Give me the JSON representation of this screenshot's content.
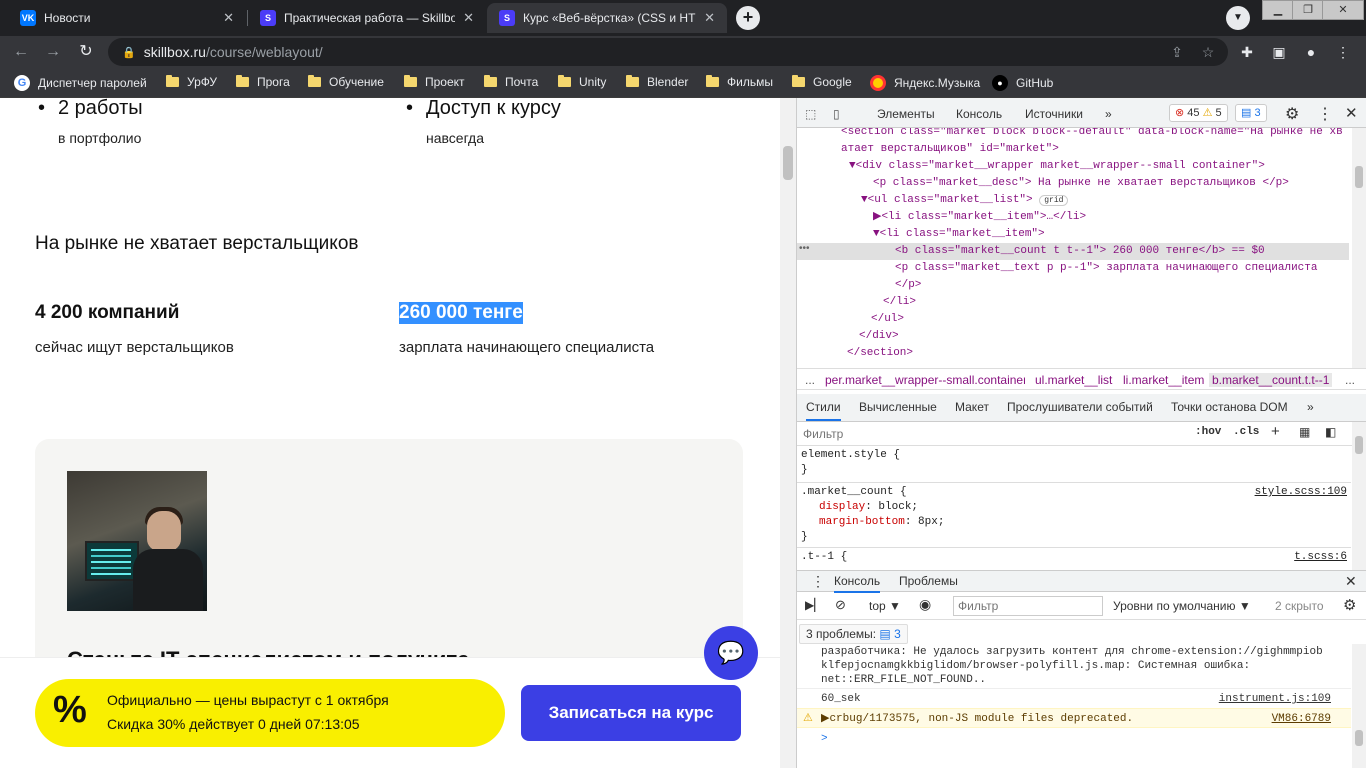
{
  "tabs": [
    {
      "title": "Новости",
      "favicon": "vk-icon",
      "color": "#0077ff",
      "glyph": "VK"
    },
    {
      "title": "Практическая работа — Skillbox",
      "favicon": "skillbox-icon",
      "color": "#4b3cf7",
      "glyph": "S"
    },
    {
      "title": "Курс «Веб-вёрстка» (CSS и HTML",
      "favicon": "skillbox-icon",
      "color": "#4b3cf7",
      "glyph": "S"
    }
  ],
  "address": {
    "host": "skillbox.ru",
    "path": "/course/weblayout/"
  },
  "bookmarks": [
    "Диспетчер паролей",
    "УрФУ",
    "Прога",
    "Обучение",
    "Проект",
    "Почта",
    "Unity",
    "Blender",
    "Фильмы",
    "Google",
    "Яндекс.Музыка",
    "GitHub"
  ],
  "page": {
    "features": [
      {
        "title": "2 работы",
        "sub": "в портфолио"
      },
      {
        "title": "Доступ к курсу",
        "sub": "навсегда"
      }
    ],
    "market_title": "На рынке не хватает верстальщиков",
    "stats": [
      {
        "value": "4 200 компаний",
        "label": "сейчас ищут верстальщиков"
      },
      {
        "value": "260 000 тенге",
        "label": "зарплата начинающего специалиста"
      }
    ],
    "card_title": "Станьте IT-специалистом и получите",
    "promo": {
      "symbol": "%",
      "line1": "Официально — цены вырастут с 1 октября",
      "line2": "Скидка 30% действует 0 дней 07:13:05"
    },
    "cta": "Записаться на курс"
  },
  "devtools": {
    "tabs": [
      "Элементы",
      "Консоль",
      "Источники"
    ],
    "errors": "45",
    "warnings": "5",
    "issues": "3",
    "dom": [
      {
        "t": "<section class=\"market block block--default\" data-block-name=\"На рынке не хв",
        "d": 0
      },
      {
        "t": "атает верстальщиков\" id=\"market\">",
        "d": 1
      },
      {
        "t": "▼<div class=\"market__wrapper market__wrapper--small container\">",
        "d": 1
      },
      {
        "t": "<p class=\"market__desc\"> На рынке не хватает верстальщиков </p>",
        "d": 2
      },
      {
        "t": "▼<ul class=\"market__list\">",
        "d": 2,
        "extra": "grid"
      },
      {
        "t": "▶<li class=\"market__item\">…</li>",
        "d": 3
      },
      {
        "t": "▼<li class=\"market__item\">",
        "d": 3
      },
      {
        "t": "<b class=\"market__count t t--1\"> 260 000 тенге</b> == $0",
        "d": 4,
        "hl": true
      },
      {
        "t": "<p class=\"market__text p p--1\"> зарплата начинающего специалиста",
        "d": 4
      },
      {
        "t": "</p>",
        "d": 4
      },
      {
        "t": "</li>",
        "d": 3
      },
      {
        "t": "</ul>",
        "d": 2
      },
      {
        "t": "</div>",
        "d": 1
      },
      {
        "t": "</section>",
        "d": 0
      }
    ],
    "crumbs": [
      "per.market__wrapper--small.container",
      "ul.market__list",
      "li.market__item",
      "b.market__count.t.t--1"
    ],
    "style_tabs": [
      "Стили",
      "Вычисленные",
      "Макет",
      "Прослушиватели событий",
      "Точки останова DOM"
    ],
    "filter_placeholder": "Фильтр",
    "filter_tools": [
      ":hov",
      ".cls"
    ],
    "rules": {
      "element": "element.style {",
      "close": "}",
      "selector": ".market__count {",
      "source": "style.scss:109",
      "p1": "display",
      "v1": ": block;",
      "p2": "margin-bottom",
      "v2": ": 8px;",
      "next": ".t--1 {",
      "next_src": "t.scss:6"
    },
    "drawer_tabs": [
      "Консоль",
      "Проблемы"
    ],
    "console": {
      "context": "top ▼",
      "filter": "Фильтр",
      "levels": "Уровни по умолчанию ▼",
      "hidden": "2 скрыто",
      "issues_label": "3 проблемы:",
      "issues_count": "3",
      "msg1a": "разработчика: Не удалось загрузить контент для chrome-extension://gighmmpiob",
      "msg1b": "klfepjocnamgkkbiglidom/browser-polyfill.js.map: Системная ошибка:",
      "msg1c": "net::ERR_FILE_NOT_FOUND..",
      "msg2": "60_sek",
      "msg2_src": "instrument.js:109",
      "msg3": "▶crbug/1173575, non-JS module files deprecated.",
      "msg3_src": "VM86:6789",
      "prompt": ">"
    }
  }
}
